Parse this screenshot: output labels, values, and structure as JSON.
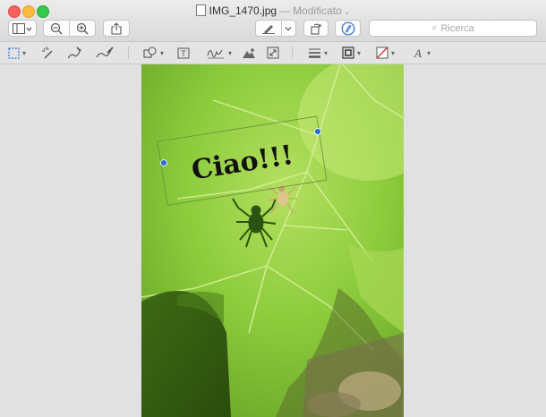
{
  "window": {
    "filename": "IMG_1470.jpg",
    "separator": "—",
    "status": "Modificato"
  },
  "toolbar": {
    "sidebar_icon": "sidebar-icon",
    "zoom_out_icon": "zoom-out-icon",
    "zoom_in_icon": "zoom-in-icon",
    "share_icon": "share-icon",
    "highlight_icon": "highlighter-icon",
    "rotate_icon": "rotate-icon",
    "markup_icon": "markup-pen-icon"
  },
  "search": {
    "placeholder": "Ricerca"
  },
  "markup_tools": [
    "selection-rect-icon",
    "instant-alpha-icon",
    "sketch-icon",
    "draw-icon",
    "shapes-icon",
    "text-box-icon",
    "sign-icon",
    "adjust-color-icon",
    "adjust-size-icon",
    "line-style-icon",
    "border-color-icon",
    "fill-color-icon",
    "text-style-icon"
  ],
  "image": {
    "annotation_text": "Ciao!!!"
  },
  "colors": {
    "accent": "#2b6fd6",
    "leaf": "#7fbf3a",
    "close": "#fc605c",
    "minimize": "#fdbc40",
    "zoom": "#34c84a"
  }
}
